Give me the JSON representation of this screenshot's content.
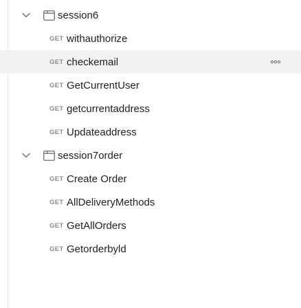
{
  "colors": {
    "get_method": "#8c8c8c",
    "text": "#212121",
    "hover_bg": "#f2f2f2",
    "icon": "#6b6b6b"
  },
  "tree": {
    "folders": [
      {
        "name": "session6",
        "expanded": true,
        "icon": "folder-icon",
        "requests": [
          {
            "method": "GET",
            "name": "withauthorize"
          },
          {
            "method": "GET",
            "name": "checkemail",
            "hovered": true,
            "more_icon": "ellipsis-icon"
          },
          {
            "method": "GET",
            "name": "GetCurrentUser"
          },
          {
            "method": "GET",
            "name": "getcurrentaddress"
          },
          {
            "method": "GET",
            "name": "Updateaddress"
          }
        ]
      },
      {
        "name": "session7order",
        "expanded": true,
        "icon": "folder-icon",
        "requests": [
          {
            "method": "GET",
            "name": "Create Order"
          },
          {
            "method": "GET",
            "name": "AllDeliveryMethods"
          },
          {
            "method": "GET",
            "name": "GetAllOrders"
          },
          {
            "method": "GET",
            "name": "Getorderbyld"
          }
        ]
      }
    ]
  }
}
